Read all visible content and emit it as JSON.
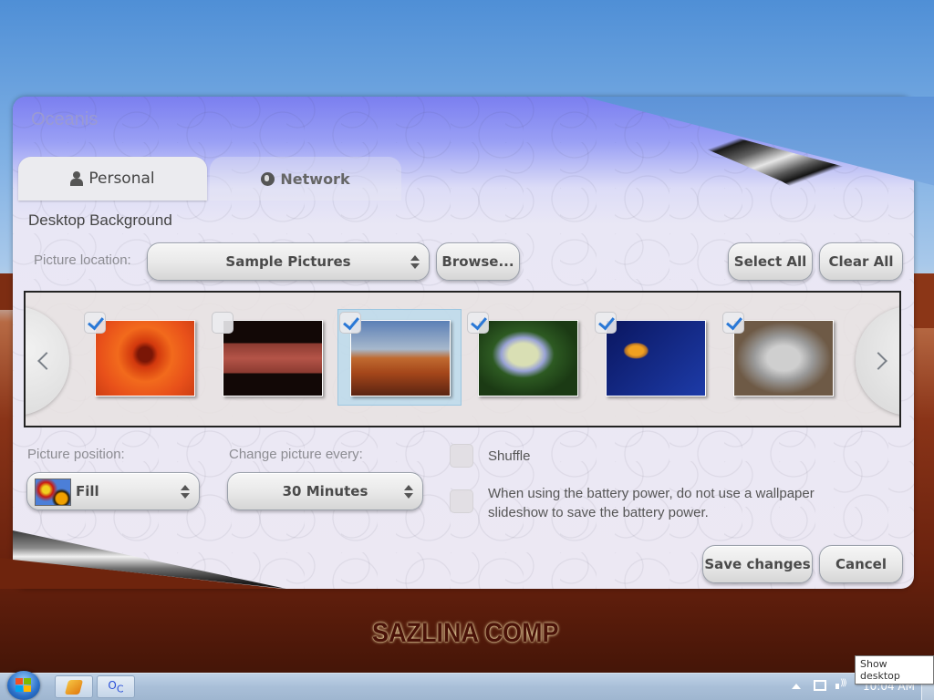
{
  "dialog": {
    "title": "Oceanis",
    "tabs": [
      {
        "label": "Personal",
        "icon": "user-icon",
        "active": true
      },
      {
        "label": "Network",
        "icon": "globe-icon",
        "active": false
      }
    ],
    "section_title": "Desktop Background",
    "picture_location": {
      "label": "Picture location:",
      "value": "Sample Pictures",
      "browse_label": "Browse..."
    },
    "select_all_label": "Select All",
    "clear_all_label": "Clear All",
    "thumbnails": [
      {
        "name": "Chrysanthemum",
        "checked": true,
        "selected": false
      },
      {
        "name": "Pattern",
        "checked": false,
        "selected": false
      },
      {
        "name": "Desert",
        "checked": true,
        "selected": true
      },
      {
        "name": "Hydrangeas",
        "checked": true,
        "selected": false
      },
      {
        "name": "Jellyfish",
        "checked": true,
        "selected": false
      },
      {
        "name": "Koala",
        "checked": true,
        "selected": false
      }
    ],
    "picture_position": {
      "label": "Picture position:",
      "value": "Fill"
    },
    "change_every": {
      "label": "Change picture every:",
      "value": "30 Minutes"
    },
    "shuffle": {
      "label": "Shuffle",
      "checked": false
    },
    "battery": {
      "label": "When using the battery power, do not use a wallpaper slideshow to save the battery power.",
      "checked": false
    },
    "save_label": "Save changes",
    "cancel_label": "Cancel"
  },
  "desktop": {
    "watermark": "SAZLINA COMP"
  },
  "taskbar": {
    "pinned": [
      {
        "name": "Winamp",
        "icon": "winamp-icon"
      },
      {
        "name": "OC",
        "icon": "oc-icon"
      }
    ],
    "clock": "10:04 AM",
    "tooltip": "Show desktop"
  },
  "colors": {
    "checkmark": "#2a78d6",
    "selection": "#aad7f0",
    "title_bar": "#7b7ff0"
  }
}
